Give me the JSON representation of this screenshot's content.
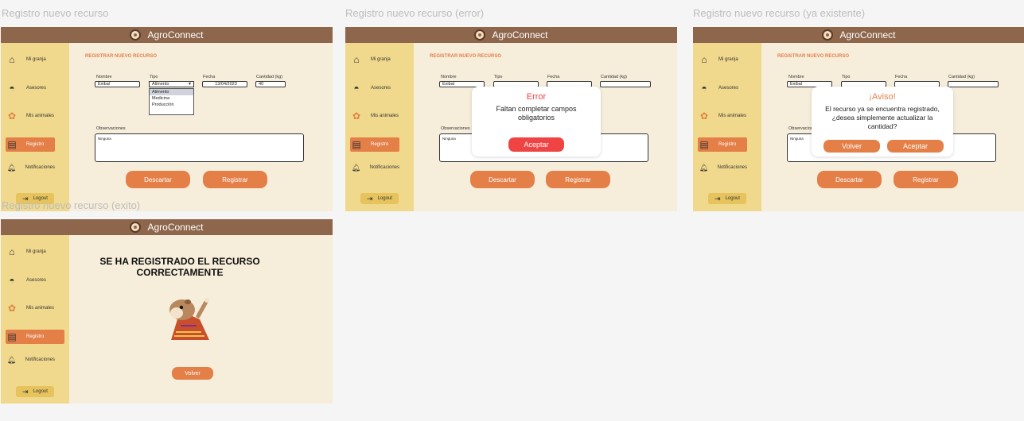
{
  "app_name": "AgroConnect",
  "colors": {
    "topbar": "#8e664c",
    "sidebar": "#f0d98d",
    "content": "#f6eedb",
    "accent": "#e47f48",
    "error": "#ef4444",
    "logout": "#e6c35c"
  },
  "sidebar": {
    "items": [
      {
        "label": "Mi granja",
        "icon": "barn-icon"
      },
      {
        "label": "Asesores",
        "icon": "farmer-hat-icon"
      },
      {
        "label": "Mis animales",
        "icon": "animals-icon"
      },
      {
        "label": "Registro",
        "icon": "clipboard-icon"
      },
      {
        "label": "Notificaciones",
        "icon": "bell-icon"
      }
    ],
    "logout": "Logout"
  },
  "form": {
    "section_title": "REGISTRAR NUEVO RECURSO",
    "nombre_label": "Nombre",
    "nombre_value": "Exibal",
    "tipo_label": "Tipo",
    "tipo_value": "Alimento",
    "tipo_options": [
      "Alimento",
      "Medicina",
      "Producción"
    ],
    "fecha_label": "Fecha",
    "fecha_value": "13/04/2023",
    "cantidad_label": "Cantidad (kg)",
    "cantidad_value": "40",
    "obs_label": "Observaciones",
    "obs_value": "Ninguna",
    "descartar": "Descartar",
    "registrar": "Registrar"
  },
  "frames": {
    "f1": "Registro nuevo recurso",
    "f2": "Registro nuevo recurso (error)",
    "f3": "Registro nuevo recurso (ya existente)",
    "f4": "Registro nuevo recurso (exito)"
  },
  "error_modal": {
    "title": "Error",
    "message": "Faltan completar campos obligatorios",
    "accept": "Aceptar"
  },
  "warning_modal": {
    "title": "¡Aviso!",
    "message": "El recurso ya se encuentra registrado, ¿desea simplemente actualizar la cantidad?",
    "back": "Volver",
    "accept": "Aceptar"
  },
  "success": {
    "message": "SE HA REGISTRADO EL RECURSO CORRECTAMENTE",
    "back": "Volver"
  }
}
